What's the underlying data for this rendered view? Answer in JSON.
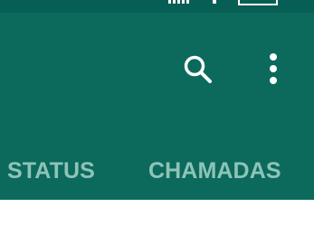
{
  "colors": {
    "status_bar": "#075e54",
    "toolbar": "#0b6a5c",
    "tab_text": "#8fc3b8",
    "icon": "#ffffff",
    "content_bg": "#ffffff"
  },
  "status_bar": {
    "icons": [
      "signal-icon",
      "wifi-icon",
      "battery-icon"
    ]
  },
  "toolbar": {
    "icons": [
      "search-icon",
      "more-vert-icon"
    ]
  },
  "tabs": [
    {
      "label": "STATUS"
    },
    {
      "label": "CHAMADAS"
    }
  ]
}
